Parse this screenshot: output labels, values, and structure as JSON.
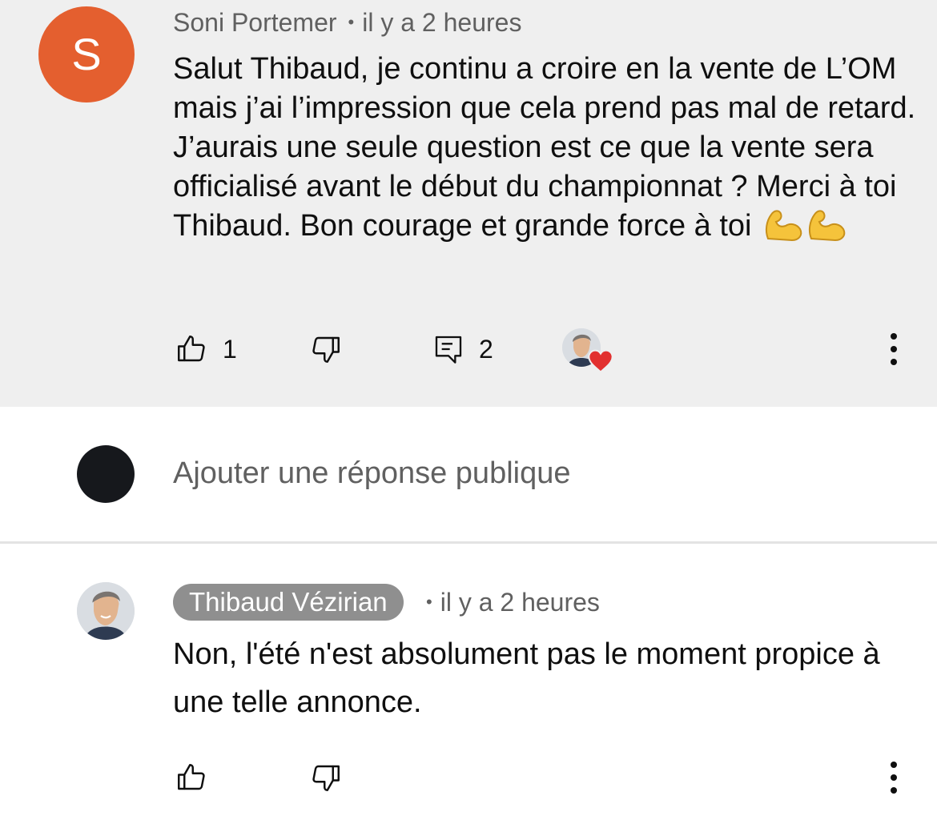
{
  "comment": {
    "avatar_letter": "S",
    "avatar_color": "#e45f2f",
    "author": "Soni Portemer",
    "separator": "•",
    "time": "il y a 2 heures",
    "text": "Salut Thibaud, je continu a croire en la vente de L’OM mais j’ai l’impression que cela prend pas mal de retard. J’aurais une seule question est ce que la vente sera officialisé avant le début du championnat ? Merci à toi Thibaud. Bon courage et grande force à toi",
    "emojis": "💪💪",
    "likes": "1",
    "replies": "2",
    "icons": {
      "like": "thumb-up-icon",
      "dislike": "thumb-down-icon",
      "reply": "comment-icon",
      "creator_heart": "creator-heart-icon",
      "more": "more-vertical-icon"
    }
  },
  "reply_box": {
    "placeholder": "Ajouter une réponse publique"
  },
  "reply": {
    "author": "Thibaud Vézirian",
    "separator": "•",
    "time": "il y a 2 heures",
    "text": "Non, l'été n'est absolument pas le moment propice à une telle annonce."
  },
  "colors": {
    "comment_bg": "#efefef",
    "author_chip_bg": "#8f8f8f",
    "heart": "#e2302f"
  }
}
